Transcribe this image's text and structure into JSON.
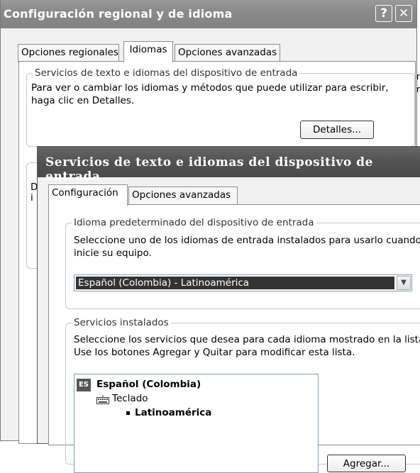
{
  "back_window": {
    "title": "Configuración regional y de idioma",
    "help_button": "?",
    "close_button": "✕",
    "tabs": [
      "Opciones regionales",
      "Idiomas",
      "Opciones avanzadas"
    ],
    "active_tab": "Idiomas",
    "group_title": "Servicios de texto e idiomas del dispositivo de entrada",
    "group_text": "Para ver o cambiar los idiomas y métodos que puede utilizar para escribir, haga clic en Detalles.",
    "details_button": "Detalles...",
    "clipped_fragments": [
      "D",
      "i"
    ],
    "right_edge_fragments": [
      "r",
      "r"
    ]
  },
  "front_window": {
    "title": "Servicios de texto e idiomas del dispositivo de entrada",
    "tabs": [
      "Configuración",
      "Opciones avanzadas"
    ],
    "active_tab": "Configuración",
    "default_language": {
      "group_title": "Idioma predeterminado del dispositivo de entrada",
      "description": "Seleccione uno de los idiomas de entrada instalados para usarlo cuando inicie su equipo.",
      "selected_value": "Español (Colombia) - Latinoamérica"
    },
    "installed_services": {
      "group_title": "Servicios instalados",
      "description": "Seleccione los servicios que desea para cada idioma mostrado en la lista. Use los botones Agregar y Quitar para modificar esta lista.",
      "tree": {
        "language_badge": "ES",
        "language": "Español (Colombia)",
        "category": "Teclado",
        "layout": "Latinoamérica"
      },
      "add_button": "Agregar..."
    }
  }
}
